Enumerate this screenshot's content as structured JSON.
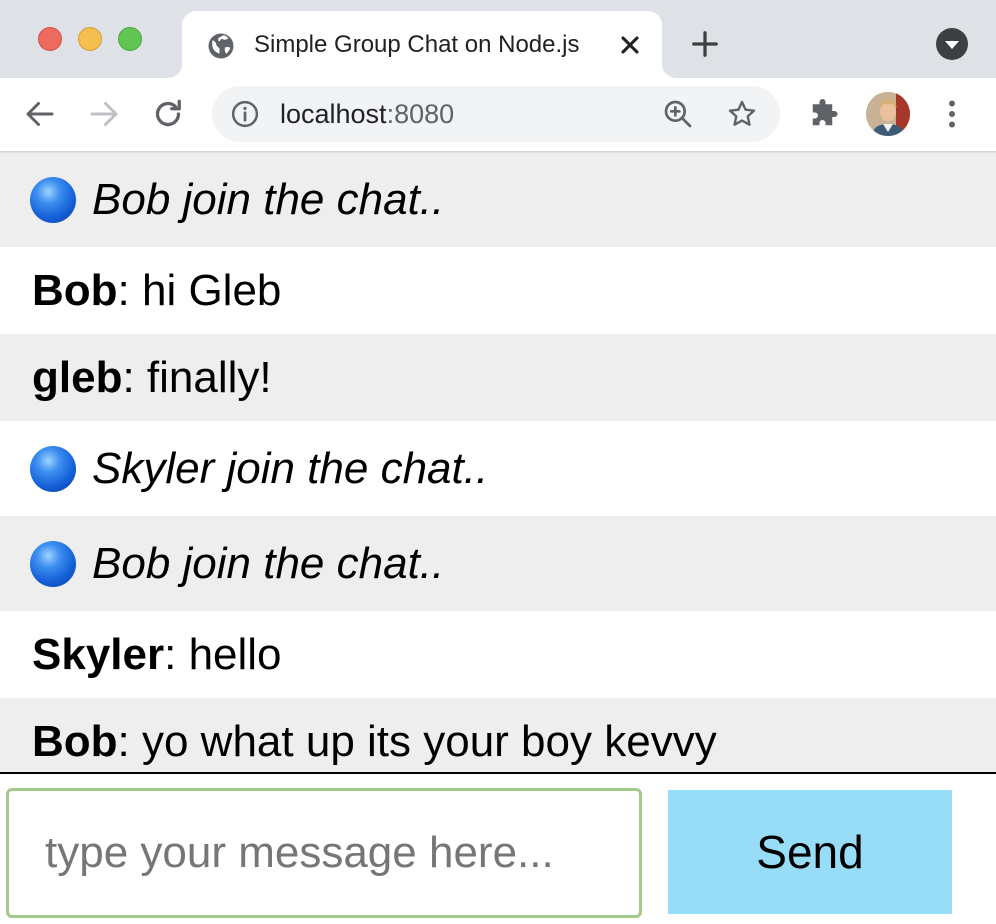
{
  "browser": {
    "tab": {
      "title": "Simple Group Chat on Node.js"
    },
    "address": {
      "host": "localhost",
      "port": ":8080"
    }
  },
  "chat": {
    "messages": [
      {
        "kind": "join",
        "text": "Bob join the chat.."
      },
      {
        "kind": "chat",
        "user": "Bob",
        "sep": ": ",
        "text": "hi Gleb"
      },
      {
        "kind": "chat",
        "user": "gleb",
        "sep": ": ",
        "text": "finally!"
      },
      {
        "kind": "join",
        "text": "Skyler join the chat.."
      },
      {
        "kind": "join",
        "text": "Bob join the chat.."
      },
      {
        "kind": "chat",
        "user": "Skyler",
        "sep": ": ",
        "text": "hello"
      },
      {
        "kind": "chat",
        "user": "Bob",
        "sep": ": ",
        "text": "yo what up its your boy kevvy"
      }
    ],
    "composer": {
      "placeholder": "type your message here...",
      "send_label": "Send"
    }
  },
  "colors": {
    "row_alt": "#eeeeee",
    "send_button": "#98ddf8",
    "input_border": "#a3c98b",
    "join_dot": "#1560d8"
  },
  "icons": [
    "globe-icon",
    "close-icon",
    "plus-icon",
    "tab-search-icon",
    "back-icon",
    "forward-icon",
    "reload-icon",
    "info-icon",
    "zoom-icon",
    "star-icon",
    "extensions-icon",
    "menu-icon"
  ]
}
